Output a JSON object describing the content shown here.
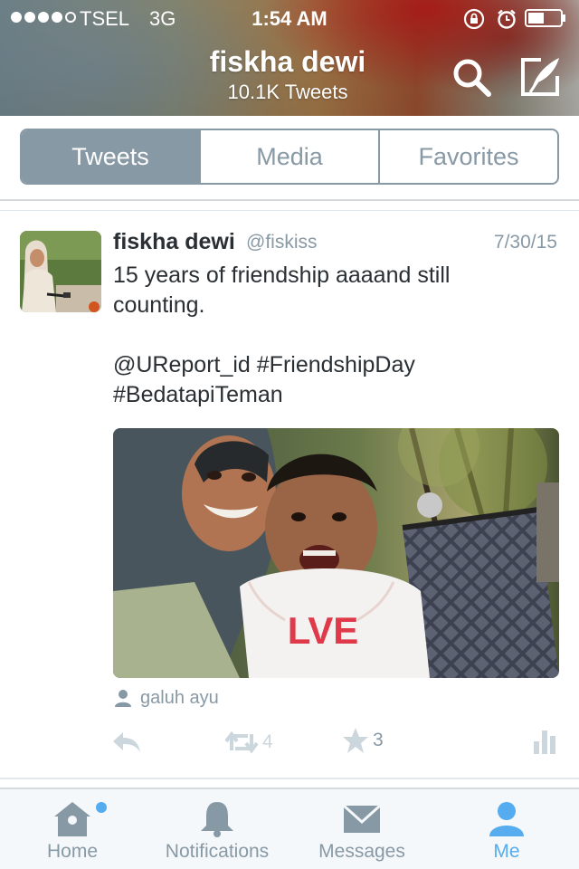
{
  "status_bar": {
    "signal_dots": 5,
    "signal_filled": 4,
    "carrier": "TSEL",
    "network": "3G",
    "time": "1:54 AM",
    "battery_level": 0.5
  },
  "profile": {
    "name": "fiskha dewi",
    "tweet_count": "10.1K Tweets"
  },
  "segments": [
    {
      "label": "Tweets",
      "active": true
    },
    {
      "label": "Media",
      "active": false
    },
    {
      "label": "Favorites",
      "active": false
    }
  ],
  "tweet": {
    "author_name": "fiskha dewi",
    "author_handle": "@fiskiss",
    "date": "7/30/15",
    "text": "15 years of friendship aaaand still counting.\n\n@UReport_id #FriendshipDay #BedatapiTeman",
    "photo_tag": "galuh ayu",
    "photo_shirt_text": "LVE",
    "retweets": "4",
    "favorites": "3"
  },
  "tab_bar": [
    {
      "label": "Home",
      "icon": "home-icon",
      "has_badge": true,
      "active": false
    },
    {
      "label": "Notifications",
      "icon": "bell-icon",
      "has_badge": false,
      "active": false
    },
    {
      "label": "Messages",
      "icon": "envelope-icon",
      "has_badge": false,
      "active": false
    },
    {
      "label": "Me",
      "icon": "person-icon",
      "has_badge": false,
      "active": true
    }
  ],
  "colors": {
    "accent": "#55acee",
    "segment": "#8899a6",
    "text": "#292f33",
    "muted": "#8899a6"
  }
}
